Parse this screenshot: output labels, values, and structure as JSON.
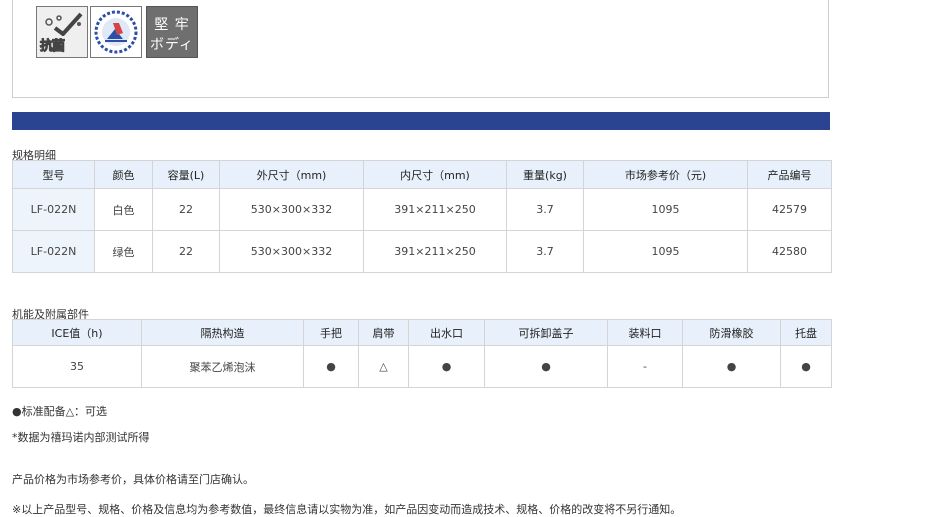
{
  "badges": {
    "antibacterial": {
      "icon": "antibacterial-icon",
      "label": "抗菌"
    },
    "seal_logo": {
      "icon": "seal-logo-icon"
    },
    "sturdy_body": {
      "line1": "堅 牢",
      "line2": "ボディ"
    }
  },
  "spec_section": {
    "title": "规格明细",
    "headers": [
      "型号",
      "颜色",
      "容量(L)",
      "外尺寸（mm)",
      "内尺寸（mm)",
      "重量(kg)",
      "市场参考价（元)",
      "产品编号"
    ],
    "rows": [
      [
        "LF-022N",
        "白色",
        "22",
        "530×300×332",
        "391×211×250",
        "3.7",
        "1095",
        "42579"
      ],
      [
        "LF-022N",
        "绿色",
        "22",
        "530×300×332",
        "391×211×250",
        "3.7",
        "1095",
        "42580"
      ]
    ]
  },
  "feature_section": {
    "title": "机能及附属部件",
    "headers": [
      "ICE值（h)",
      "隔热构造",
      "手把",
      "肩带",
      "出水口",
      "可拆卸盖子",
      "装料口",
      "防滑橡胶",
      "托盘"
    ],
    "rows": [
      [
        "35",
        "聚苯乙烯泡沫",
        "●",
        "△",
        "●",
        "●",
        "-",
        "●",
        "●"
      ]
    ]
  },
  "notes": {
    "legend": "●标准配备△：可选",
    "data_note": "*数据为禧玛诺内部测试所得",
    "price_note": "产品价格为市场参考价，具体价格请至门店确认。",
    "disclaimer": "※以上产品型号、规格、价格及信息均为参考数值，最终信息请以实物为准，如产品因变动而造成技术、规格、价格的改变将不另行通知。"
  },
  "colors": {
    "header_bar": "#2b4492",
    "table_header_bg": "#e8f1fb"
  }
}
